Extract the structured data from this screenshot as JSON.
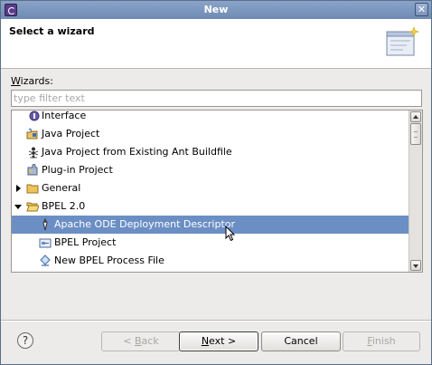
{
  "window": {
    "title": "New"
  },
  "banner": {
    "title": "Select a wizard"
  },
  "wizards": {
    "label_mnemonic": "W",
    "label_rest": "izards:",
    "filter_placeholder": "type filter text",
    "filter_value": ""
  },
  "tree": {
    "items": [
      {
        "label": "Interface",
        "icon": "interface-icon",
        "indent": 1,
        "selected": false
      },
      {
        "label": "Java Project",
        "icon": "java-project-icon",
        "indent": 1,
        "selected": false
      },
      {
        "label": "Java Project from Existing Ant Buildfile",
        "icon": "ant-icon",
        "indent": 1,
        "selected": false
      },
      {
        "label": "Plug-in Project",
        "icon": "plugin-icon",
        "indent": 1,
        "selected": false
      },
      {
        "label": "General",
        "icon": "folder-icon",
        "indent": 1,
        "expander": "collapsed",
        "selected": false
      },
      {
        "label": "BPEL 2.0",
        "icon": "folder-open-icon",
        "indent": 1,
        "expander": "expanded",
        "selected": false
      },
      {
        "label": "Apache ODE Deployment Descriptor",
        "icon": "deploy-descriptor-icon",
        "indent": 2,
        "selected": true
      },
      {
        "label": "BPEL Project",
        "icon": "bpel-project-icon",
        "indent": 2,
        "selected": false
      },
      {
        "label": "New BPEL Process File",
        "icon": "bpel-process-icon",
        "indent": 2,
        "selected": false
      }
    ]
  },
  "buttons": {
    "back_mnemonic": "B",
    "back_prefix": "< ",
    "back_rest": "ack",
    "next_mnemonic": "N",
    "next_rest": "ext >",
    "cancel": "Cancel",
    "finish_mnemonic": "F",
    "finish_rest": "inish",
    "help": "?"
  },
  "colors": {
    "selection": "#6b8fc4",
    "titlebar": "#7b96bd"
  }
}
